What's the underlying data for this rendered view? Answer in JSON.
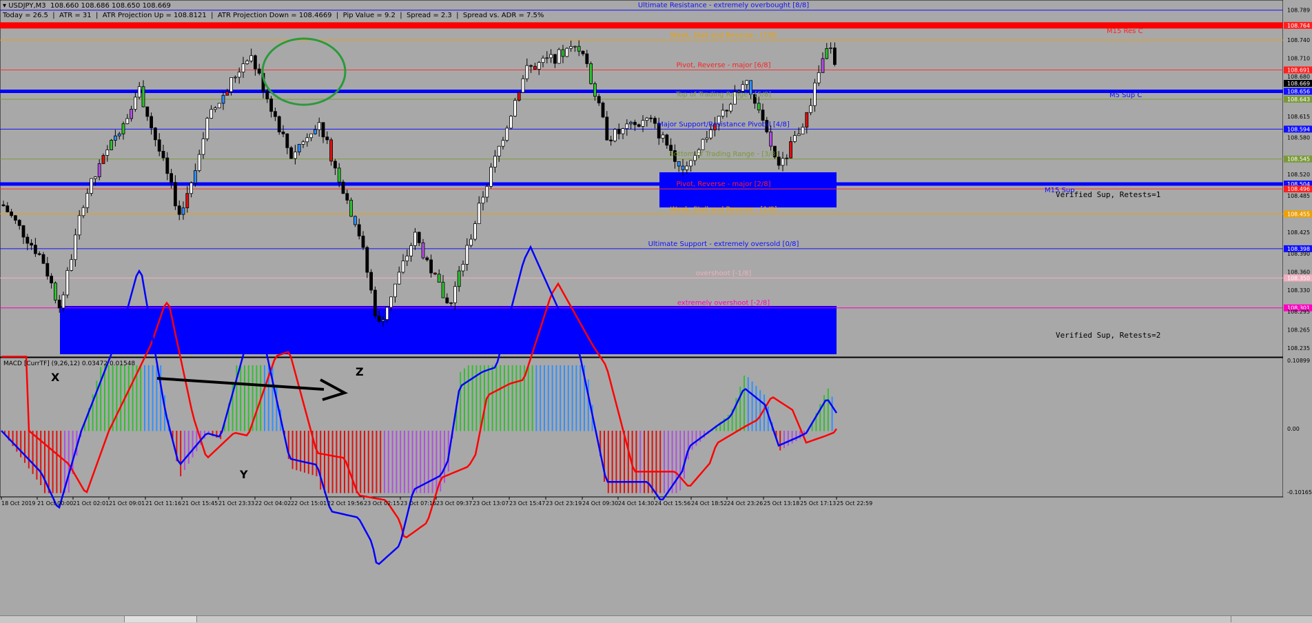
{
  "header": {
    "symbol": "USDJPY,M3",
    "ohlc": "108.660 108.686 108.650 108.669",
    "stats": [
      "Today = 26.5",
      "ATR = 31",
      "ATR Projection Up = 108.8121",
      "ATR Projection Down = 108.4669",
      "Pip Value = 9.2",
      "Spread = 2.3",
      "Spread vs. ADR = 7.5%"
    ]
  },
  "price_axis": {
    "ticks": [
      "108.789",
      "108.764",
      "108.740",
      "108.710",
      "108.691",
      "108.680",
      "108.669",
      "108.656",
      "108.643",
      "108.615",
      "108.594",
      "108.580",
      "108.545",
      "108.520",
      "108.504",
      "108.496",
      "108.485",
      "108.455",
      "108.425",
      "108.398",
      "108.390",
      "108.360",
      "108.350",
      "108.330",
      "108.301",
      "108.295",
      "108.265",
      "108.235"
    ],
    "tagged": [
      {
        "label": "108.764",
        "color": "#ff2020"
      },
      {
        "label": "108.691",
        "color": "#ff2020"
      },
      {
        "label": "108.669",
        "color": "#000000"
      },
      {
        "label": "108.656",
        "color": "#1010ff"
      },
      {
        "label": "108.643",
        "color": "#7a9a3a"
      },
      {
        "label": "108.594",
        "color": "#1010ff"
      },
      {
        "label": "108.545",
        "color": "#7a9a3a"
      },
      {
        "label": "108.504",
        "color": "#1010ff"
      },
      {
        "label": "108.496",
        "color": "#ff2020"
      },
      {
        "label": "108.455",
        "color": "#f0a000"
      },
      {
        "label": "108.398",
        "color": "#1010ff"
      },
      {
        "label": "108.350",
        "color": "#f0b0c0"
      },
      {
        "label": "108.301",
        "color": "#ff00c0"
      }
    ]
  },
  "murrey_levels": [
    {
      "label": "Ultimate Resistance - extremely overbought [8/8]",
      "color": "#1010ff"
    },
    {
      "label": "Weak, Stall and Reverse - [7/8]",
      "color": "#f0a000"
    },
    {
      "label": "Pivot, Reverse - major [6/8]",
      "color": "#ff2020"
    },
    {
      "label": "Top of Trading Range - [5/8]",
      "color": "#7a9a3a"
    },
    {
      "label": "Major Support/Resistance Pivotal [4/8]",
      "color": "#1010ff"
    },
    {
      "label": "Bottom of Trading Range - [3/8]",
      "color": "#7a9a3a"
    },
    {
      "label": "Pivot, Reverse - major [2/8]",
      "color": "#ff2020"
    },
    {
      "label": "Weak, Stall and Reverse - [1/8]",
      "color": "#f0a000"
    },
    {
      "label": "Ultimate Support - extremely oversold [0/8]",
      "color": "#1010ff"
    },
    {
      "label": "overshoot [-1/8]",
      "color": "#f0b0c0"
    },
    {
      "label": "extremely overshoot [-2/8]",
      "color": "#ff00c0"
    }
  ],
  "zone_labels": {
    "m15_res": "M15 Res C",
    "m5_sup": "M5 Sup C",
    "m15_sup": "M15 Sup",
    "verified_1": "Verified Sup, Retests=1",
    "verified_2": "Verified Sup, Retests=2"
  },
  "annotations": {
    "x": "X",
    "y": "Y",
    "z": "Z"
  },
  "macd": {
    "title": "MACD [CurrTF] (9,26,12) 0.03472 0.01548",
    "ticks": [
      "0.10899",
      "0.00",
      "-0.10165"
    ]
  },
  "time_axis": [
    "18 Oct 2019",
    "21 Oct 00:00",
    "21 Oct 02:01",
    "21 Oct 09:01",
    "21 Oct 11:16",
    "21 Oct 15:45",
    "21 Oct 23:33",
    "22 Oct 04:02",
    "22 Oct 15:01",
    "22 Oct 19:56",
    "23 Oct 02:15",
    "23 Oct 07:16",
    "23 Oct 09:37",
    "23 Oct 13:07",
    "23 Oct 15:47",
    "23 Oct 23:19",
    "24 Oct 09:30",
    "24 Oct 14:30",
    "24 Oct 15:56",
    "24 Oct 18:52",
    "24 Oct 23:26",
    "25 Oct 13:18",
    "25 Oct 17:13",
    "25 Oct 22:59"
  ]
}
